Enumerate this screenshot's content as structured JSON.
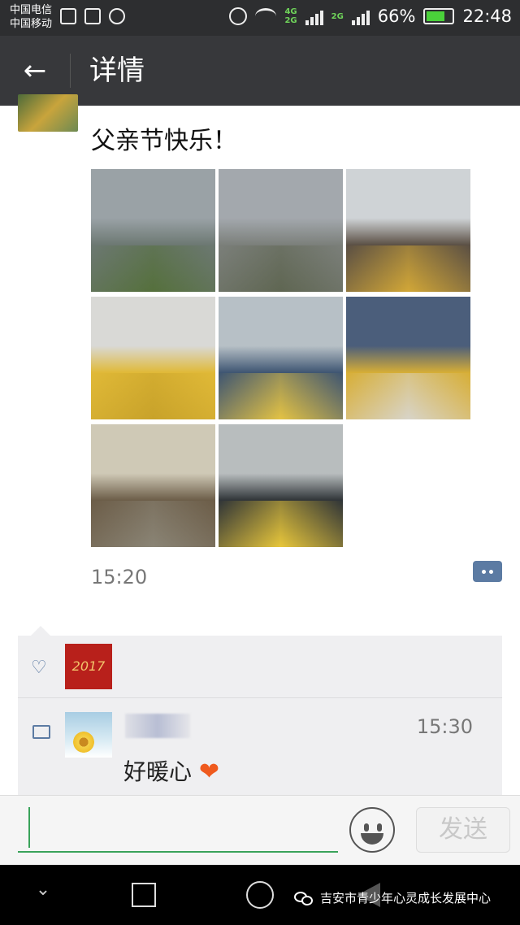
{
  "status_bar": {
    "carrier_1": "中国电信",
    "carrier_2": "中国移动",
    "network_badge_1": "4G",
    "network_badge_2": "2G",
    "network_badge_3": "2G",
    "battery": "66%",
    "time": "22:48"
  },
  "header": {
    "title": "详情"
  },
  "post": {
    "text": "父亲节快乐！",
    "time": "15:20",
    "photos": [
      {
        "name": "city-overcast",
        "colors": [
          "#9aa2a6",
          "#6c7872",
          "#55703c"
        ]
      },
      {
        "name": "rooftop-view",
        "colors": [
          "#a3a8ad",
          "#7b7f7a",
          "#5f6652"
        ]
      },
      {
        "name": "classroom-crowd",
        "colors": [
          "#cfd3d6",
          "#5a4f44",
          "#d2a737"
        ]
      },
      {
        "name": "kids-yellow-vests",
        "colors": [
          "#d9d9d6",
          "#e0b937",
          "#c8a22a"
        ]
      },
      {
        "name": "computer-lab",
        "colors": [
          "#b7c0c6",
          "#3e5572",
          "#e3c244"
        ]
      },
      {
        "name": "boy-birthday-cake",
        "colors": [
          "#4b5e7b",
          "#d7ae36",
          "#d8d4c8"
        ]
      },
      {
        "name": "father-and-son",
        "colors": [
          "#cfc9b6",
          "#6c5d48",
          "#8a8475"
        ]
      },
      {
        "name": "boy-eating-cake",
        "colors": [
          "#b8bdbe",
          "#2f3438",
          "#e7c63a"
        ]
      }
    ]
  },
  "interactions": {
    "like_avatar_text": "2017",
    "comment_time": "15:30",
    "comment_text": "好暖心"
  },
  "input_bar": {
    "send_label": "发送"
  },
  "watermark": {
    "text": "吉安市青少年心灵成长发展中心"
  },
  "colors": {
    "accent_green": "#3aa35a",
    "link_blue": "#5c7ba3",
    "title_bar": "#37383b"
  }
}
